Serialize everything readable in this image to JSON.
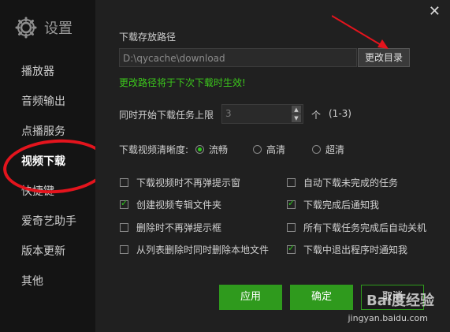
{
  "sidebar": {
    "title": "设置",
    "items": [
      {
        "label": "播放器"
      },
      {
        "label": "音频输出"
      },
      {
        "label": "点播服务"
      },
      {
        "label": "视频下载"
      },
      {
        "label": "快捷键"
      },
      {
        "label": "爱奇艺助手"
      },
      {
        "label": "版本更新"
      },
      {
        "label": "其他"
      }
    ]
  },
  "download": {
    "path_label": "下载存放路径",
    "path_value": "D:\\qycache\\download",
    "change_button": "更改目录",
    "path_hint": "更改路径将于下次下载时生效!",
    "max_tasks_label": "同时开始下载任务上限",
    "max_tasks_value": "3",
    "max_tasks_unit": "个",
    "max_tasks_range": "(1-3)",
    "quality_label": "下载视频清晰度:",
    "quality_options": [
      {
        "label": "流畅",
        "selected": true
      },
      {
        "label": "高清",
        "selected": false
      },
      {
        "label": "超清",
        "selected": false
      }
    ],
    "checkboxes": [
      {
        "label": "下载视频时不再弹提示窗",
        "checked": false
      },
      {
        "label": "自动下载未完成的任务",
        "checked": false
      },
      {
        "label": "创建视频专辑文件夹",
        "checked": true
      },
      {
        "label": "下载完成后通知我",
        "checked": true
      },
      {
        "label": "删除时不再弹提示框",
        "checked": false
      },
      {
        "label": "所有下载任务完成后自动关机",
        "checked": false
      },
      {
        "label": "从列表删除时同时删除本地文件",
        "checked": false
      },
      {
        "label": "下载中退出程序时通知我",
        "checked": true
      }
    ]
  },
  "buttons": {
    "apply": "应用",
    "ok": "确定",
    "cancel": "取消"
  },
  "watermark": {
    "brand": "Bai度经验",
    "url": "jingyan.baidu.com"
  },
  "colors": {
    "accent_green": "#2f9a1d",
    "hint_green": "#3cc71c",
    "annotation_red": "#e4141d"
  }
}
